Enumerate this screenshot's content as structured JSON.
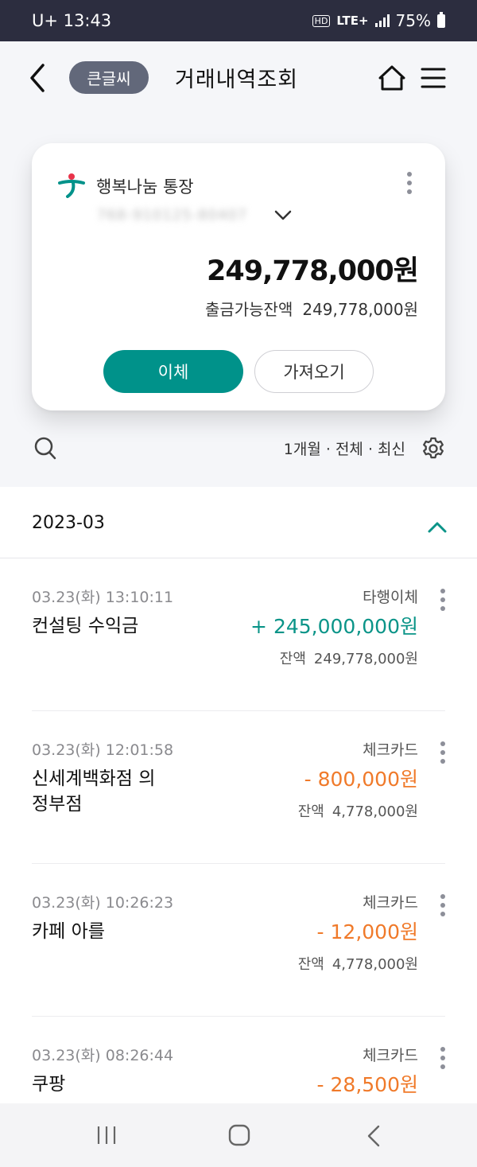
{
  "status_bar": {
    "carrier_time": "U+ 13:43",
    "hd": "HD",
    "network": "LTE+",
    "battery": "75%"
  },
  "header": {
    "chip_label": "큰글씨",
    "title": "거래내역조회"
  },
  "account_card": {
    "account_name": "행복나눔 통장",
    "account_number": "768-910125-80407",
    "balance": "249,778,000원",
    "available_label": "출금가능잔액",
    "available_value": "249,778,000원",
    "transfer_button": "이체",
    "bring_button": "가져오기",
    "brand_color": "#00928a"
  },
  "filter": {
    "summary": "1개월 · 전체 · 최신"
  },
  "month_header": {
    "month": "2023-03"
  },
  "transactions": [
    {
      "datetime": "03.23(화) 13:10:11",
      "type": "타행이체",
      "name": "컨설팅 수익금",
      "amount": "+ 245,000,000원",
      "direction": "in",
      "balance_label": "잔액",
      "balance": "249,778,000원"
    },
    {
      "datetime": "03.23(화) 12:01:58",
      "type": "체크카드",
      "name": "신세계백화점 의정부점",
      "amount": "- 800,000원",
      "direction": "out",
      "balance_label": "잔액",
      "balance": "4,778,000원"
    },
    {
      "datetime": "03.23(화) 10:26:23",
      "type": "체크카드",
      "name": "카페 아를",
      "amount": "- 12,000원",
      "direction": "out",
      "balance_label": "잔액",
      "balance": "4,778,000원"
    },
    {
      "datetime": "03.23(화) 08:26:44",
      "type": "체크카드",
      "name": "쿠팡",
      "amount": "- 28,500원",
      "direction": "out",
      "balance_label": "",
      "balance": ""
    }
  ],
  "colors": {
    "status_bar": "#2c2d3f",
    "income": "#0a9488",
    "expense": "#f07a2a"
  }
}
